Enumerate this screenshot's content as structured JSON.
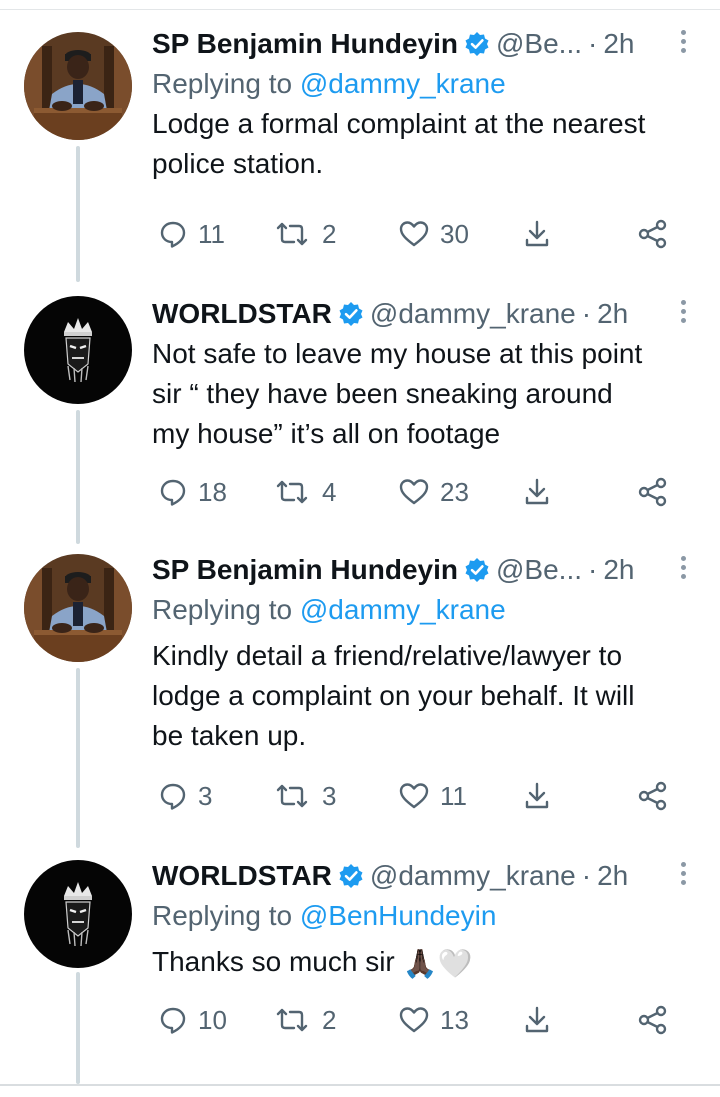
{
  "tweets": [
    {
      "name": "SP Benjamin Hundeyin",
      "handle": "@Be...",
      "dot": "·",
      "time": "2h",
      "reply_prefix": "Replying to ",
      "reply_to": "@dammy_krane",
      "lines": [
        "Lodge a formal complaint at the nearest",
        "police station."
      ],
      "replies": "11",
      "retweets": "2",
      "likes": "30",
      "avatar": "police-officer-avatar"
    },
    {
      "name": "WORLDSTAR",
      "handle": "@dammy_krane",
      "dot": "·",
      "time": "2h",
      "reply_prefix": "",
      "reply_to": "",
      "lines": [
        "Not safe to leave my house at this point",
        "sir  “ they have been sneaking around",
        "my house” it’s all on footage"
      ],
      "replies": "18",
      "retweets": "4",
      "likes": "23",
      "avatar": "crowned-face-avatar"
    },
    {
      "name": "SP Benjamin Hundeyin",
      "handle": "@Be...",
      "dot": "·",
      "time": "2h",
      "reply_prefix": "Replying to ",
      "reply_to": "@dammy_krane",
      "lines": [
        "Kindly detail a friend/relative/lawyer to",
        "lodge a complaint on your behalf. It will",
        "be taken up."
      ],
      "replies": "3",
      "retweets": "3",
      "likes": "11",
      "avatar": "police-officer-avatar"
    },
    {
      "name": "WORLDSTAR",
      "handle": "@dammy_krane",
      "dot": "·",
      "time": "2h",
      "reply_prefix": "Replying to ",
      "reply_to": "@BenHundeyin",
      "lines": [
        "Thanks so much sir"
      ],
      "emoji": "🙏🏿🤍",
      "replies": "10",
      "retweets": "2",
      "likes": "13",
      "avatar": "crowned-face-avatar"
    }
  ],
  "colors": {
    "text": "#0f1419",
    "secondary": "#536471",
    "link": "#1d9bf0",
    "verified": "#1d9bf0",
    "thread_line": "#cfd9de"
  }
}
